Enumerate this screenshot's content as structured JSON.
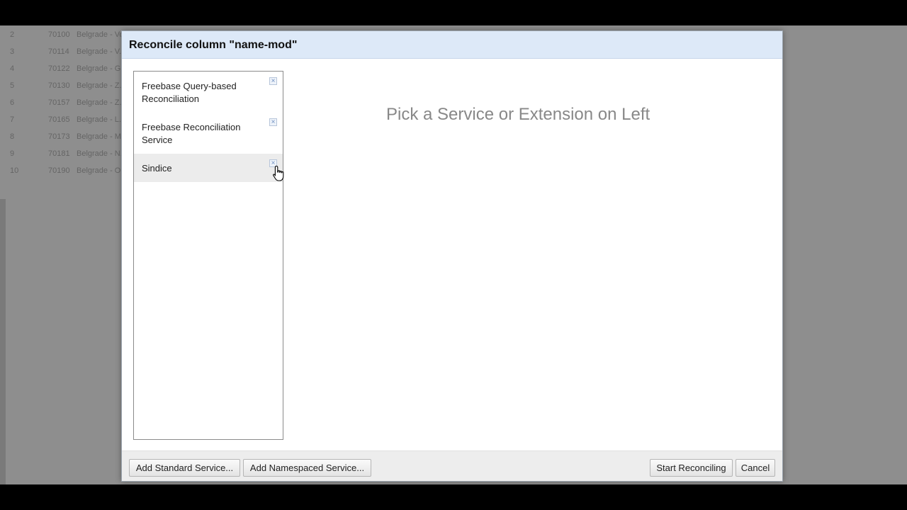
{
  "background_rows": [
    {
      "n": "2",
      "id": "70100",
      "name": "Belgrade - Vozdovac..."
    },
    {
      "n": "3",
      "id": "70114",
      "name": "Belgrade - V..."
    },
    {
      "n": "4",
      "id": "70122",
      "name": "Belgrade - G..."
    },
    {
      "n": "5",
      "id": "70130",
      "name": "Belgrade - Z..."
    },
    {
      "n": "6",
      "id": "70157",
      "name": "Belgrade - Z..."
    },
    {
      "n": "7",
      "id": "70165",
      "name": "Belgrade - L..."
    },
    {
      "n": "8",
      "id": "70173",
      "name": "Belgrade - M..."
    },
    {
      "n": "9",
      "id": "70181",
      "name": "Belgrade - N..."
    },
    {
      "n": "10",
      "id": "70190",
      "name": "Belgrade - O..."
    }
  ],
  "dialog": {
    "title": "Reconcile column \"name-mod\"",
    "placeholder": "Pick a Service or Extension on Left",
    "services": [
      {
        "label": "Freebase Query-based Reconciliation",
        "selected": false
      },
      {
        "label": "Freebase Reconciliation Service",
        "selected": false
      },
      {
        "label": "Sindice",
        "selected": true
      }
    ],
    "remove_glyph": "×",
    "buttons": {
      "add_standard": "Add Standard Service...",
      "add_namespaced": "Add Namespaced Service...",
      "start": "Start Reconciling",
      "cancel": "Cancel"
    }
  }
}
